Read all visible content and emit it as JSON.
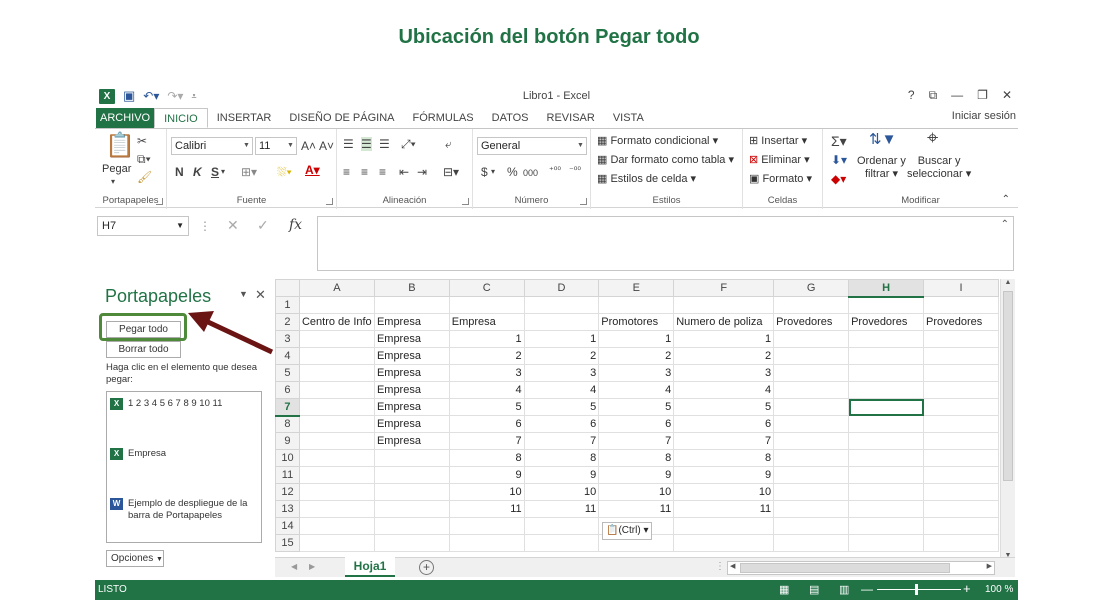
{
  "slide": {
    "title": "Ubicación del botón Pegar todo"
  },
  "window": {
    "title": "Libro1 - Excel",
    "controls": {
      "help": "?",
      "restore_ribbon": "⧉",
      "minimize": "—",
      "restore": "❐",
      "close": "✕"
    },
    "signin": "Iniciar sesión"
  },
  "tabs": [
    "ARCHIVO",
    "INICIO",
    "INSERTAR",
    "DISEÑO DE PÁGINA",
    "FÓRMULAS",
    "DATOS",
    "REVISAR",
    "VISTA"
  ],
  "ribbon": {
    "groups": {
      "clipboard": "Portapapeles",
      "font": "Fuente",
      "alignment": "Alineación",
      "number": "Número",
      "styles": "Estilos",
      "cells": "Celdas",
      "edit": "Modificar"
    },
    "paste": "Pegar",
    "font_name": "Calibri",
    "font_size": "11",
    "bold": "N",
    "italic": "K",
    "underline": "S",
    "number_format": "General",
    "currency": "$",
    "percent": "%",
    "thousands": "000",
    "conditional_format": "Formato condicional",
    "format_table": "Dar formato como tabla",
    "cell_styles": "Estilos de celda",
    "insert": "Insertar",
    "delete": "Eliminar",
    "format": "Formato",
    "sort_filter_1": "Ordenar y",
    "sort_filter_2": "filtrar",
    "find_select_1": "Buscar y",
    "find_select_2": "seleccionar"
  },
  "formula_bar": {
    "name_box": "H7",
    "fx": "fx"
  },
  "clipboard_pane": {
    "title": "Portapapeles",
    "paste_all": "Pegar todo",
    "clear_all": "Borrar todo",
    "instruction": "Haga clic en el elemento que desea pegar:",
    "items": [
      {
        "type": "excel",
        "text": "1 2 3 4 5 6 7 8 9 10 11"
      },
      {
        "type": "excel",
        "text": "Empresa"
      },
      {
        "type": "word",
        "text": "Ejemplo de despliegue de la barra de Portapapeles"
      }
    ],
    "options": "Opciones"
  },
  "sheet": {
    "columns": [
      "A",
      "B",
      "C",
      "D",
      "E",
      "F",
      "G",
      "H",
      "I"
    ],
    "selected_column": "H",
    "selected_row": 7,
    "rows": [
      {
        "n": "1",
        "cells": [
          "",
          "",
          "",
          "",
          "",
          "",
          "",
          "",
          ""
        ]
      },
      {
        "n": "2",
        "cells": [
          "Centro de Info",
          "Empresa",
          "Empresa",
          "",
          "Promotores",
          "Numero de poliza",
          "Provedores",
          "Provedores",
          "Provedores"
        ]
      },
      {
        "n": "3",
        "cells": [
          "",
          "Empresa",
          "1",
          "1",
          "1",
          "1",
          "",
          "",
          ""
        ]
      },
      {
        "n": "4",
        "cells": [
          "",
          "Empresa",
          "2",
          "2",
          "2",
          "2",
          "",
          "",
          ""
        ]
      },
      {
        "n": "5",
        "cells": [
          "",
          "Empresa",
          "3",
          "3",
          "3",
          "3",
          "",
          "",
          ""
        ]
      },
      {
        "n": "6",
        "cells": [
          "",
          "Empresa",
          "4",
          "4",
          "4",
          "4",
          "",
          "",
          ""
        ]
      },
      {
        "n": "7",
        "cells": [
          "",
          "Empresa",
          "5",
          "5",
          "5",
          "5",
          "",
          "",
          ""
        ]
      },
      {
        "n": "8",
        "cells": [
          "",
          "Empresa",
          "6",
          "6",
          "6",
          "6",
          "",
          "",
          ""
        ]
      },
      {
        "n": "9",
        "cells": [
          "",
          "Empresa",
          "7",
          "7",
          "7",
          "7",
          "",
          "",
          ""
        ]
      },
      {
        "n": "10",
        "cells": [
          "",
          "",
          "8",
          "8",
          "8",
          "8",
          "",
          "",
          ""
        ]
      },
      {
        "n": "11",
        "cells": [
          "",
          "",
          "9",
          "9",
          "9",
          "9",
          "",
          "",
          ""
        ]
      },
      {
        "n": "12",
        "cells": [
          "",
          "",
          "10",
          "10",
          "10",
          "10",
          "",
          "",
          ""
        ]
      },
      {
        "n": "13",
        "cells": [
          "",
          "",
          "11",
          "11",
          "11",
          "11",
          "",
          "",
          ""
        ]
      },
      {
        "n": "14",
        "cells": [
          "",
          "",
          "",
          "",
          "",
          "",
          "",
          "",
          ""
        ]
      },
      {
        "n": "15",
        "cells": [
          "",
          "",
          "",
          "",
          "",
          "",
          "",
          "",
          ""
        ]
      }
    ],
    "paste_options": "(Ctrl)",
    "sheet_tab": "Hoja1",
    "add_sheet": "+"
  },
  "status": {
    "ready": "LISTO",
    "zoom": "100 %"
  },
  "colors": {
    "accent": "#217346",
    "arrow": "#6b1414",
    "highlight": "#4e8a3a"
  }
}
